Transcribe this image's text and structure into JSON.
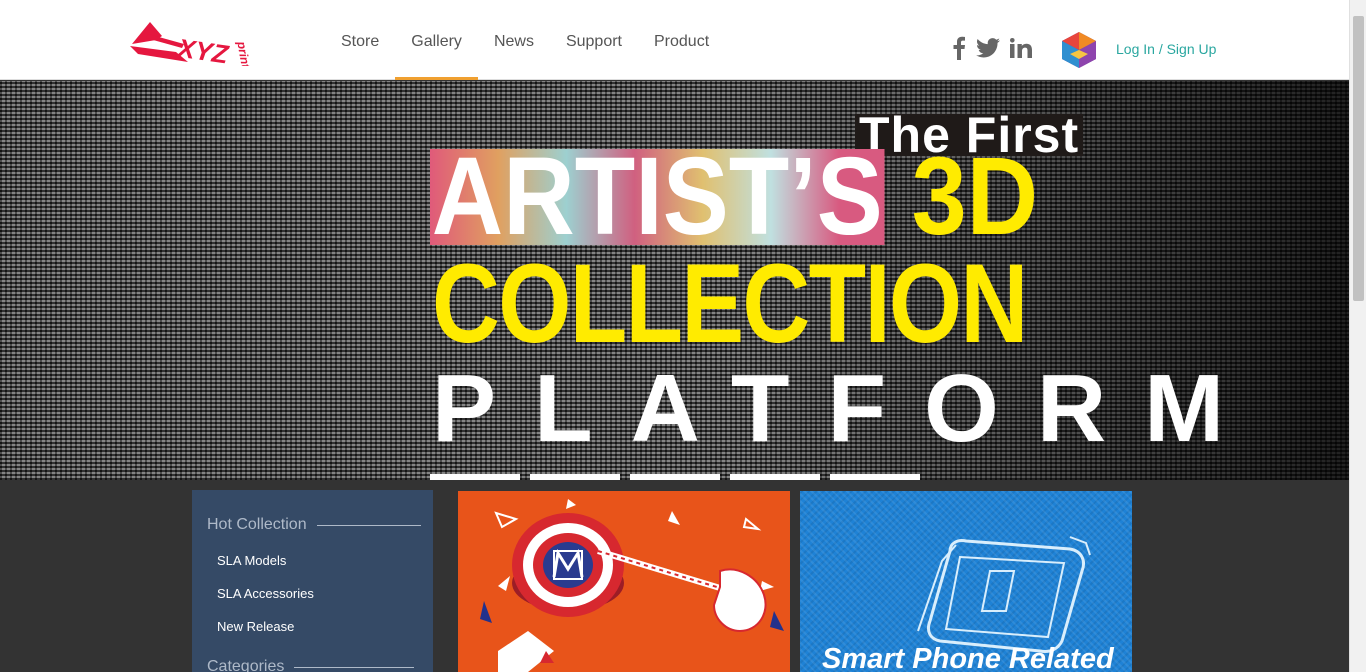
{
  "header": {
    "logo_alt": "XYZprinting",
    "nav": [
      {
        "label": "Store"
      },
      {
        "label": "Gallery",
        "active": true
      },
      {
        "label": "News"
      },
      {
        "label": "Support"
      },
      {
        "label": "Product"
      }
    ],
    "social_icons": [
      "facebook-icon",
      "twitter-icon",
      "linkedin-icon"
    ],
    "login_label": "Log In / Sign Up",
    "accent_color": "#f0a030",
    "link_color": "#2aa7a0"
  },
  "hero": {
    "line1": "The First",
    "line2a": "ARTIST’S",
    "line2b": "3D",
    "line3": "COLLECTION",
    "line4": "PLATFORM",
    "slides_count": 5,
    "highlight_color": "#ffeb00"
  },
  "sidebar": {
    "heading1": "Hot Collection",
    "items": [
      {
        "label": "SLA Models"
      },
      {
        "label": "SLA Accessories"
      },
      {
        "label": "New Release"
      }
    ],
    "heading2": "Categories"
  },
  "tiles": [
    {
      "name": "captain-shield"
    },
    {
      "name": "smart-phone",
      "caption": "Smart Phone Related"
    }
  ]
}
